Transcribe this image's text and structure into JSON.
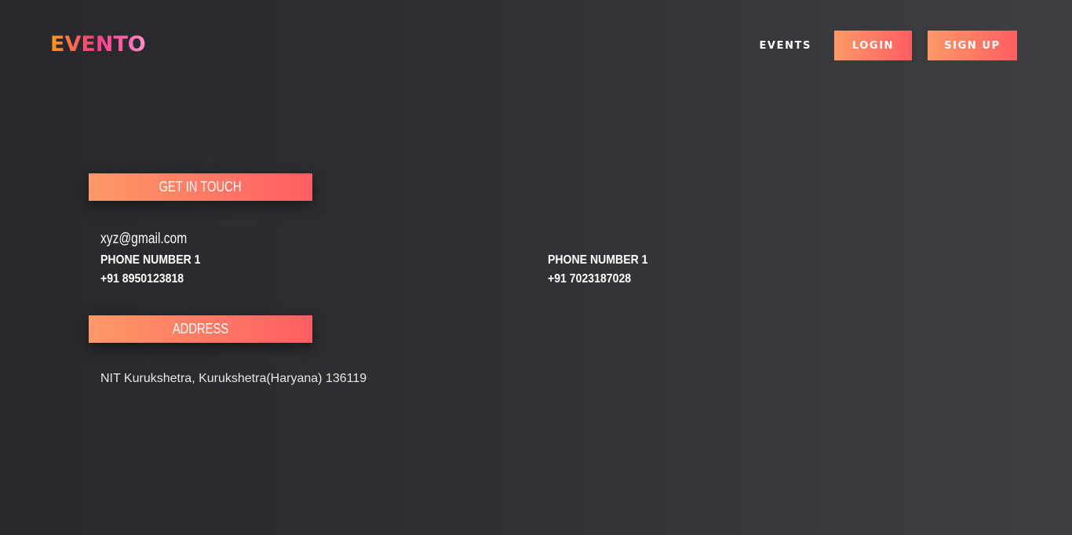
{
  "header": {
    "logo": "EVENTO",
    "nav": {
      "events": "EVENTS",
      "login": "LOGIN",
      "signup": "SIGN UP"
    }
  },
  "contact": {
    "heading": "GET IN TOUCH",
    "email": "xyz@gmail.com",
    "phones": [
      {
        "label": "PHONE NUMBER 1",
        "number": "+91 8950123818"
      },
      {
        "label": "PHONE NUMBER 1",
        "number": "+91 7023187028"
      }
    ]
  },
  "address": {
    "heading": "ADDRESS",
    "text": "NIT Kurukshetra, Kurukshetra(Haryana) 136119"
  },
  "colors": {
    "accent_start": "#ff9966",
    "accent_end": "#ff5e62",
    "background": "#2f3033"
  }
}
